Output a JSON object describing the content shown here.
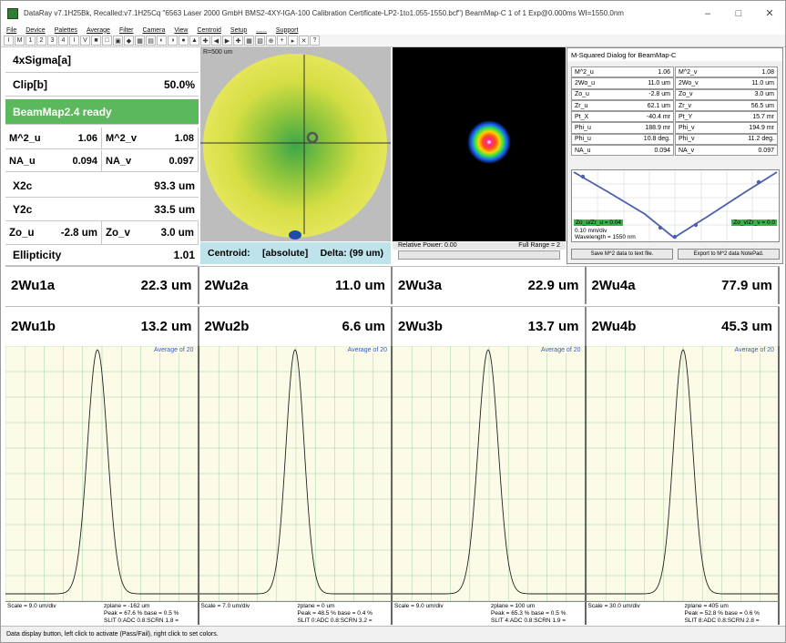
{
  "window": {
    "title": "DataRay v7.1H25Bk, Recalled:v7.1H25Cq \"6563 Laser 2000 GmbH BMS2-4XY-IGA-100 Calibration Certificate-LP2-1to1.055-1550.bcf\")   BeamMap-C 1 of 1   Exp@0.000ms   WI=1550.0nm",
    "minimize": "–",
    "maximize": "□",
    "close": "✕"
  },
  "menu": [
    "File",
    "Device",
    "Palettes",
    "Average",
    "Filter",
    "Camera",
    "View",
    "Centroid",
    "Setup",
    "......",
    "Support"
  ],
  "toolbar": [
    "I",
    "M",
    "1",
    "2",
    "3",
    "4",
    "I",
    "V",
    "■",
    "□",
    "▣",
    "◆",
    "▦",
    "▤",
    "◐",
    "◑",
    "●",
    "▲",
    "✚",
    "◀",
    "▶",
    "✚",
    "▦",
    "▧",
    "⊕",
    "+",
    "▸",
    "✕",
    "?"
  ],
  "left_panel": {
    "sigma": "4xSigma[a]",
    "clip_label": "Clip[b]",
    "clip_value": "50.0%",
    "status": "BeamMap2.4 ready",
    "m2u_label": "M^2_u",
    "m2u_value": "1.06",
    "m2v_label": "M^2_v",
    "m2v_value": "1.08",
    "nau_label": "NA_u",
    "nau_value": "0.094",
    "nav_label": "NA_v",
    "nav_value": "0.097",
    "x2c_label": "X2c",
    "x2c_value": "93.3 um",
    "y2c_label": "Y2c",
    "y2c_value": "33.5 um",
    "zou_label": "Zo_u",
    "zou_value": "-2.8 um",
    "zov_label": "Zo_v",
    "zov_value": "3.0 um",
    "ellip_label": "Ellipticity",
    "ellip_value": "1.01"
  },
  "beam_view": {
    "radius_label": "R=500 um"
  },
  "centroid": {
    "label": "Centroid:",
    "mode": "[absolute]",
    "delta": "Delta: (99 um)"
  },
  "beam_2d": {
    "relative_power": "Relative Power: 0.00",
    "full_range": "Full Range = 2"
  },
  "msq": {
    "title": "M-Squared Dialog for BeamMap-C",
    "rows": [
      [
        {
          "k": "M^2_u",
          "v": "1.06"
        },
        {
          "k": "M^2_v",
          "v": "1.08"
        }
      ],
      [
        {
          "k": "2Wo_u",
          "v": "11.0 um"
        },
        {
          "k": "2Wo_v",
          "v": "11.0 um"
        }
      ],
      [
        {
          "k": "Zo_u",
          "v": "-2.8 um"
        },
        {
          "k": "Zo_v",
          "v": "3.0 um"
        }
      ],
      [
        {
          "k": "Zr_u",
          "v": "62.1 um"
        },
        {
          "k": "Zr_v",
          "v": "56.5 um"
        }
      ],
      [
        {
          "k": "Pt_X",
          "v": "-40.4 mr"
        },
        {
          "k": "Pt_Y",
          "v": "15.7 mr"
        }
      ],
      [
        {
          "k": "Phi_u",
          "v": "188.9 mr"
        },
        {
          "k": "Phi_v",
          "v": "194.9 mr"
        }
      ],
      [
        {
          "k": "Phi_u",
          "v": "10.8 deg."
        },
        {
          "k": "Phi_v",
          "v": "11.2 deg."
        }
      ],
      [
        {
          "k": "NA_u",
          "v": "0.094"
        },
        {
          "k": "NA_v",
          "v": "0.097"
        }
      ]
    ],
    "zo_u_tag": "Zo_u/Zr_u = 0.04",
    "zo_v_tag": "Zo_v/Zr_v = 0.0",
    "scale": "0.10 mm/div",
    "wavelength": "Wavelength = 1550 nm",
    "save_button": "Save M^2 data to text file.",
    "export_button": "Export to M^2 data NotePad."
  },
  "readouts_a": [
    {
      "label": "2Wu1a",
      "value": "22.3 um"
    },
    {
      "label": "2Wu2a",
      "value": "11.0 um"
    },
    {
      "label": "2Wu3a",
      "value": "22.9 um"
    },
    {
      "label": "2Wu4a",
      "value": "77.9 um"
    }
  ],
  "readouts_b": [
    {
      "label": "2Wu1b",
      "value": "13.2 um"
    },
    {
      "label": "2Wu2b",
      "value": "6.6 um"
    },
    {
      "label": "2Wu3b",
      "value": "13.7 um"
    },
    {
      "label": "2Wu4b",
      "value": "45.3 um"
    }
  ],
  "plots": [
    {
      "avg": "Average of 20",
      "scale": "Scale = 9.0 um/div",
      "zplane": "zplane = -162 um",
      "peak": "Peak = 67.6 %  base = 0.5 %",
      "slit": "SLIT 0:ADC 0.8:SCRN 1.8 ="
    },
    {
      "avg": "Average of 20",
      "scale": "Scale = 7.0 um/div",
      "zplane": "zplane = 0 um",
      "peak": "Peak = 48.5 %  base = 0.4 %",
      "slit": "SLIT 0:ADC 0.8:SCRN 3.2 ="
    },
    {
      "avg": "Average of 20",
      "scale": "Scale = 9.0 um/div",
      "zplane": "zplane = 100 um",
      "peak": "Peak = 65.3 %  base = 0.5 %",
      "slit": "SLIT 4:ADC 0.8:SCRN 1.9 ="
    },
    {
      "avg": "Average of 20",
      "scale": "Scale = 30.0 um/div",
      "zplane": "zplane = 405 um",
      "peak": "Peak = 52.8 %  base = 0.6 %",
      "slit": "SLIT 8:ADC 0.8:SCRN 2.8 ="
    }
  ],
  "statusbar": "Data display button, left click to activate (Pass/Fail), right click to set colors.",
  "colors": {
    "status_green": "#5cb85c",
    "centroid_bg": "#bfe3ea",
    "plot_bg": "#fbfbe8",
    "grid": "#9fd39f",
    "curve": "#222222",
    "msq_line": "#4a5fb0"
  }
}
